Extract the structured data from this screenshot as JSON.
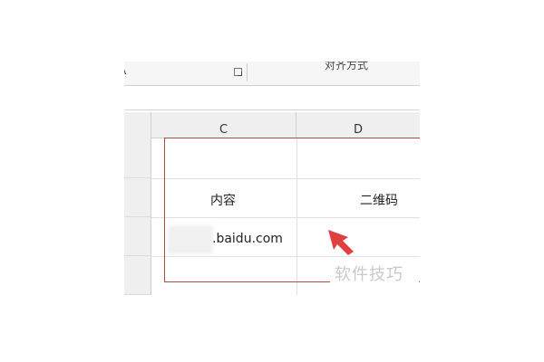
{
  "ribbon": {
    "left_label_fragment": "A",
    "group_label": "对齐方式"
  },
  "columns": [
    {
      "header": "C"
    },
    {
      "header": "D"
    }
  ],
  "cells": {
    "c_content_header": "内容",
    "d_qrcode_header": "二维码",
    "c_url": ".baidu.com"
  },
  "annotation": {
    "arrow_color": "#e04040",
    "selection_color": "#b24a44"
  },
  "watermark": {
    "text": "软件技巧"
  }
}
